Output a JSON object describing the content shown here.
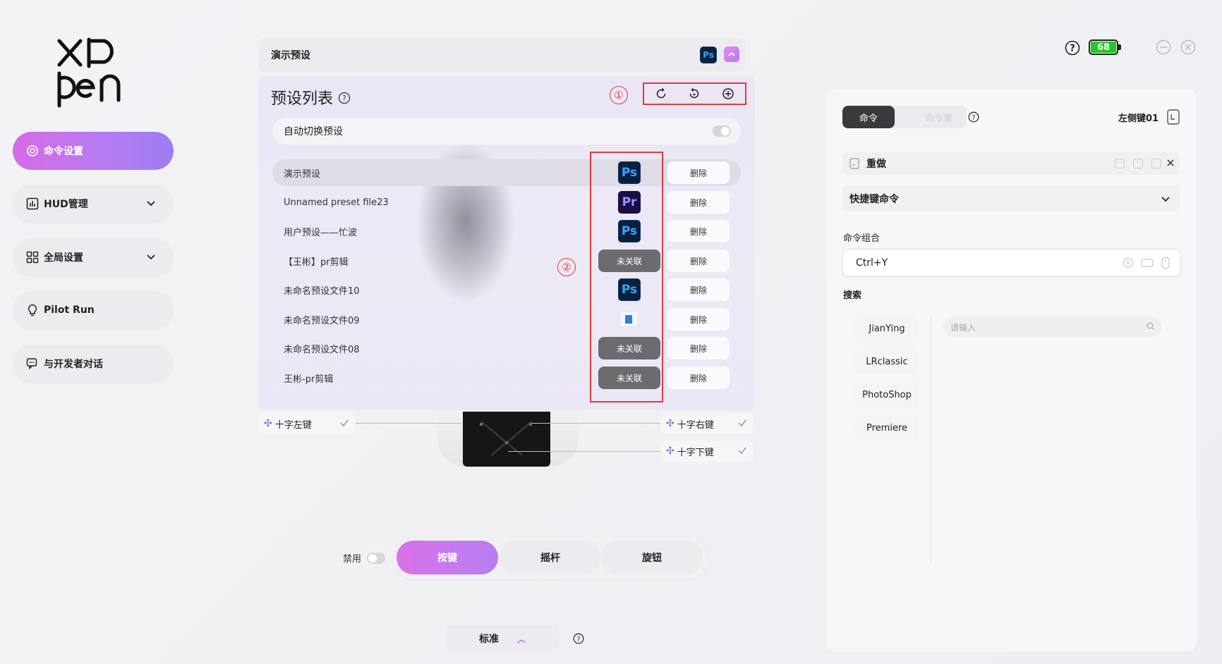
{
  "brand": {
    "logo_text": "XPpen"
  },
  "sidebar": {
    "items": [
      {
        "label": "命令设置",
        "icon": "target-icon",
        "active": true
      },
      {
        "label": "HUD管理",
        "icon": "bar-chart-icon",
        "expandable": true
      },
      {
        "label": "全局设置",
        "icon": "grid-icon",
        "expandable": true
      },
      {
        "label": "Pilot Run",
        "icon": "lightbulb-icon"
      },
      {
        "label": "与开发者对话",
        "icon": "chat-icon"
      }
    ]
  },
  "preset_header": {
    "title": "演示预设",
    "app_badge": "Ps"
  },
  "preset_panel": {
    "title": "预设列表",
    "annotation_1": "①",
    "annotation_2": "②",
    "auto_switch_label": "自动切换预设",
    "presets": [
      {
        "name": "演示预设",
        "app": "Ps",
        "selected": true
      },
      {
        "name": "Unnamed preset file23",
        "app": "Pr"
      },
      {
        "name": "用户预设——忙波",
        "app": "Ps"
      },
      {
        "name": "【王彬】pr剪辑",
        "app": "未关联"
      },
      {
        "name": "未命名预设文件10",
        "app": "Ps"
      },
      {
        "name": "未命名预设文件09",
        "app": "blank"
      },
      {
        "name": "未命名预设文件08",
        "app": "未关联"
      },
      {
        "name": "王彬-pr剪辑",
        "app": "未关联"
      }
    ],
    "delete_label": "删除"
  },
  "device": {
    "left_key": "十字左键",
    "right_key": "十字右键",
    "down_key": "十字下键"
  },
  "bottom": {
    "disable_label": "禁用",
    "tabs": [
      "按键",
      "摇杆",
      "旋钮"
    ],
    "active_tab": "按键",
    "mode_label": "标准"
  },
  "status": {
    "battery": "68",
    "battery_color": "#22c922"
  },
  "right_panel": {
    "tab_active": "命令",
    "tab_inactive": "命令集",
    "key_name": "左侧键01",
    "command_name": "重做",
    "command_type": "快捷键命令",
    "combo_label": "命令组合",
    "combo_value": "Ctrl+Y",
    "search_label": "搜索",
    "apps": [
      "JianYing",
      "LRclassic",
      "PhotoShop",
      "Premiere"
    ],
    "search_placeholder": "请输入"
  },
  "colors": {
    "accent": "#b87cf0",
    "annotation_red": "#e53a3a"
  }
}
